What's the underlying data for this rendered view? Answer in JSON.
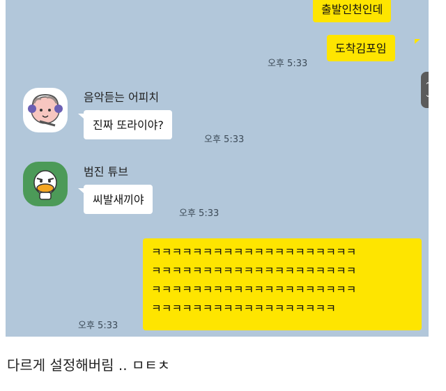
{
  "messages": {
    "m1": {
      "text": "출발인천인데"
    },
    "m2": {
      "text": "도착김포임",
      "time": "오후 5:33"
    },
    "m3": {
      "sender": "음악듣는 어피치",
      "text": "진짜 또라이야?",
      "time": "오후 5:33"
    },
    "m4": {
      "sender": "범진 튜브",
      "text": "씨발새끼야",
      "time": "오후 5:33"
    },
    "m5": {
      "lines": [
        "ㅋㅋㅋㅋㅋㅋㅋㅋㅋㅋㅋㅋㅋㅋㅋㅋㅋㅋㅋㅋ",
        "ㅋㅋㅋㅋㅋㅋㅋㅋㅋㅋㅋㅋㅋㅋㅋㅋㅋㅋㅋㅋ",
        "ㅋㅋㅋㅋㅋㅋㅋㅋㅋㅋㅋㅋㅋㅋㅋㅋㅋㅋㅋㅋ",
        "ㅋㅋㅋㅋㅋㅋㅋㅋㅋㅋㅋㅋㅋㅋㅋㅋㅋㅋ"
      ],
      "time": "오후 5:33"
    }
  },
  "caption": "다르게 설정해버림 .. ㅁㅌㅊ",
  "icons": {
    "avatar1": "apeach-headphones-avatar-icon",
    "avatar2": "tube-duck-avatar-icon",
    "scroll": "scroll-up-down-icon"
  },
  "colors": {
    "chat_background": "#b2c7da",
    "my_bubble": "#fee500",
    "other_bubble": "#ffffff"
  }
}
